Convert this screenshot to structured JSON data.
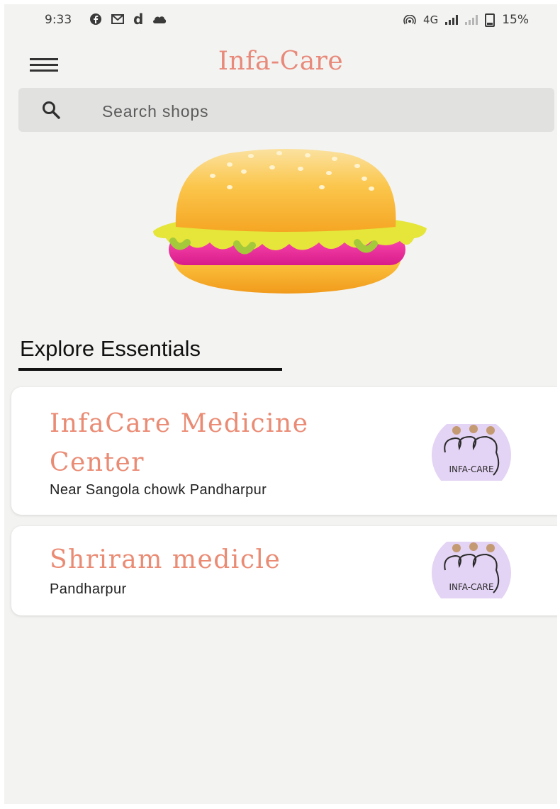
{
  "status_bar": {
    "time": "9:33",
    "network": "4G",
    "battery": "15%",
    "left_icons": [
      "facebook-icon",
      "gmail-icon",
      "d-app-icon",
      "cloud-icon"
    ]
  },
  "app_bar": {
    "title": "Infa-Care",
    "menu_icon": "hamburger-menu-icon"
  },
  "search": {
    "placeholder": "Search shops"
  },
  "hero": {
    "image": "burger-illustration"
  },
  "section": {
    "title": "Explore Essentials"
  },
  "shops": [
    {
      "name": "InfaCare Medicine Center",
      "address": "Near Sangola chowk Pandharpur",
      "logo_text": "INFA-CARE"
    },
    {
      "name": "Shriram medicle",
      "address": "Pandharpur",
      "logo_text": "INFA-CARE"
    }
  ],
  "colors": {
    "accent": "#e8897a",
    "background": "#f3f3f1",
    "search_bg": "#e1e1e0",
    "logo_bg": "#e3d3f4"
  }
}
